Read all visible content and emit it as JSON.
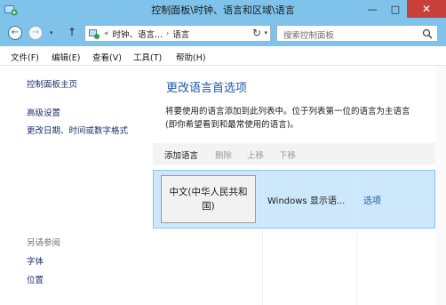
{
  "window": {
    "title": "控制面板\\时钟、语言和区域\\语言",
    "minimize": "—",
    "maximize": "□",
    "close": "✕",
    "icon": "control-panel-icon",
    "title_bar_color": "#7fc3ea",
    "close_color": "#c7413a"
  },
  "navigation": {
    "back": "←",
    "forward": "→",
    "recent_dropdown": "▾",
    "up": "↑",
    "refresh": "↻",
    "address": {
      "overflow": "«",
      "crumbs": [
        "时钟、语言...",
        "语言"
      ],
      "separator": "›",
      "dropdown": "▾"
    },
    "search": {
      "placeholder": "搜索控制面板"
    }
  },
  "menubar": {
    "items": [
      "文件(F)",
      "编辑(E)",
      "查看(V)",
      "工具(T)",
      "帮助(H)"
    ]
  },
  "sidebar": {
    "home": "控制面板主页",
    "links": [
      "高级设置",
      "更改日期、时间或数字格式"
    ],
    "see_also": {
      "heading": "另请参阅",
      "links": [
        "字体",
        "位置"
      ]
    }
  },
  "main": {
    "title": "更改语言首选项",
    "description_lines": [
      "将要使用的语言添加到此列表中。位于列表第一位的语言为主语言",
      "(即你希望看到和最常使用的语言)。"
    ],
    "toolbar": {
      "add": "添加语言",
      "remove": "删除",
      "move_up": "上移",
      "move_down": "下移"
    },
    "languages": [
      {
        "name": "中文(中华人民共和国)",
        "info": "Windows 显示语...",
        "options": "选项"
      }
    ],
    "accent_color": "#1e5aa8",
    "selected_row_color": "#cde8fb"
  }
}
